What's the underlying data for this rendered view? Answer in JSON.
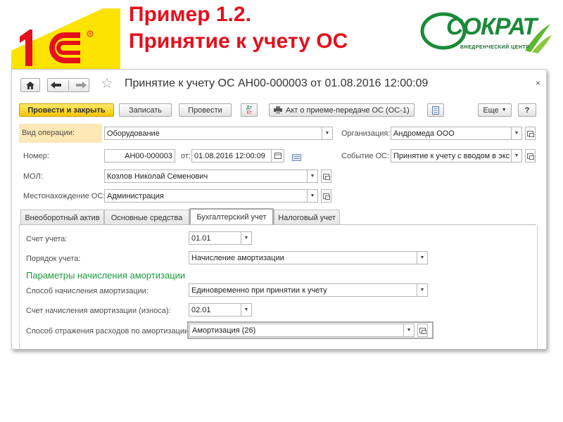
{
  "slide": {
    "title_line1": "Пример 1.2.",
    "title_line2": "Принятие к учету ОС"
  },
  "logos": {
    "sokrat_word": "СОКРАТ",
    "sokrat_sub": "ВНЕДРЕНЧЕСКИЙ ЦЕНТР",
    "brand_red": "#e4101d",
    "brand_green": "#1a8a3a"
  },
  "window": {
    "title": "Принятие к учету ОС АН00-000003 от 01.08.2016 12:00:09",
    "icons": [
      "home-icon",
      "back-arrow-icon",
      "forward-arrow-icon",
      "star-icon",
      "close-icon"
    ]
  },
  "toolbar": {
    "post_close": "Провести и закрыть",
    "save": "Записать",
    "post": "Провести",
    "dtkt_top": "Дт",
    "dtkt_bottom": "Кт",
    "act_print": "Акт о приеме-передаче ОС (ОС-1)",
    "more": "Еще",
    "help": "?"
  },
  "header": {
    "operation_label": "Вид операции:",
    "operation_value": "Оборудование",
    "org_label": "Организация:",
    "org_value": "Андромеда ООО",
    "number_label": "Номер:",
    "number_value": "АН00-000003",
    "date_from_label": "от:",
    "date_value": "01.08.2016 12:00:09",
    "event_label": "Событие ОС:",
    "event_value": "Принятие к учету с вводом в экс",
    "mol_label": "МОЛ:",
    "mol_value": "Козлов Николай Семенович",
    "location_label": "Местонахождение ОС:",
    "location_value": "Администрация"
  },
  "tabs": [
    {
      "label": "Внеоборотный актив",
      "active": false
    },
    {
      "label": "Основные средства",
      "active": false
    },
    {
      "label": "Бухгалтерский учет",
      "active": true
    },
    {
      "label": "Налоговый учет",
      "active": false
    }
  ],
  "accounting": {
    "account_label": "Счет учета:",
    "account_value": "01.01",
    "order_label": "Порядок учета:",
    "order_value": "Начисление амортизации",
    "section_title": "Параметры начисления амортизации",
    "method_label": "Способ начисления амортизации:",
    "method_value": "Единовременно при принятии к учету",
    "deprec_account_label": "Счет начисления амортизации (износа):",
    "deprec_account_value": "02.01",
    "expense_label": "Способ отражения расходов по амортизации:",
    "expense_value": "Амортизация (26)"
  }
}
